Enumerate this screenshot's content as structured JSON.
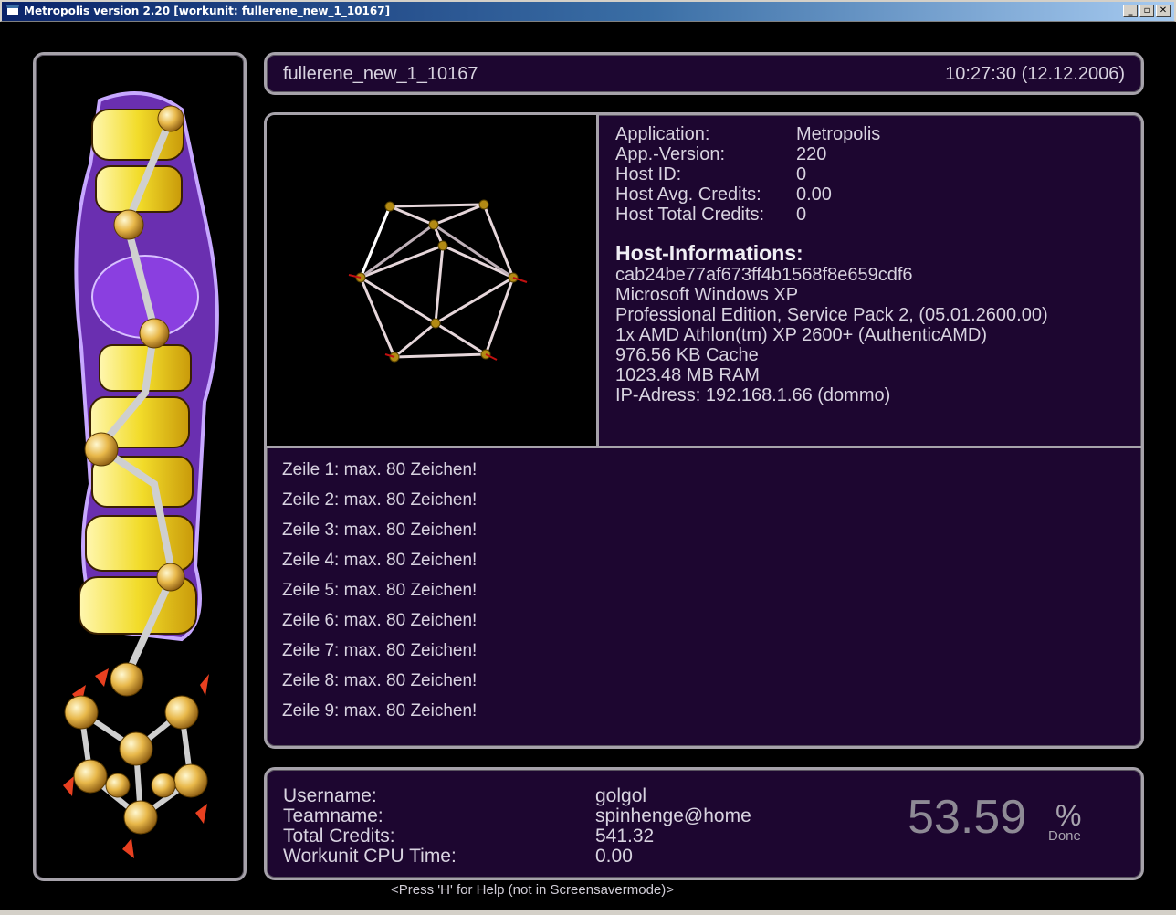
{
  "window": {
    "title": "Metropolis version 2.20 [workunit: fullerene_new_1_10167]",
    "buttons": [
      "_",
      "▫",
      "✕"
    ]
  },
  "header": {
    "workunit": "fullerene_new_1_10167",
    "datetime": "10:27:30 (12.12.2006)"
  },
  "app_info": [
    {
      "key": "Application:",
      "value": "Metropolis"
    },
    {
      "key": "App.-Version:",
      "value": "220"
    },
    {
      "key": "Host ID:",
      "value": "0"
    },
    {
      "key": "Host Avg. Credits:",
      "value": "0.00"
    },
    {
      "key": "Host Total Credits:",
      "value": "0"
    }
  ],
  "host": {
    "title": "Host-Informations:",
    "lines": [
      "cab24be77af673ff4b1568f8e659cdf6",
      "Microsoft Windows XP",
      "Professional Edition, Service Pack 2, (05.01.2600.00)",
      "1x AMD Athlon(tm) XP 2600+ (AuthenticAMD)",
      "976.56 KB Cache",
      "1023.48 MB RAM",
      "IP-Adress: 192.168.1.66 (dommo)"
    ]
  },
  "zeilen": [
    "Zeile 1: max. 80 Zeichen!",
    "Zeile 2: max. 80 Zeichen!",
    "Zeile 3: max. 80 Zeichen!",
    "Zeile 4: max. 80 Zeichen!",
    "Zeile 5: max. 80 Zeichen!",
    "Zeile 6: max. 80 Zeichen!",
    "Zeile 7: max. 80 Zeichen!",
    "Zeile 8: max. 80 Zeichen!",
    "Zeile 9: max. 80 Zeichen!"
  ],
  "user": [
    {
      "key": "Username:",
      "value": "golgol"
    },
    {
      "key": "Teamname:",
      "value": "spinhenge@home"
    },
    {
      "key": "Total Credits:",
      "value": "541.32"
    },
    {
      "key": "Workunit CPU Time:",
      "value": "0.00"
    }
  ],
  "progress": {
    "value": "53.59",
    "sign": "%",
    "label": "Done",
    "fraction": 0.5359
  },
  "help": "<Press 'H' for Help (not in Screensavermode)>",
  "colors": {
    "panel_bg": "#1d0630",
    "panel_border": "#a6a2aa",
    "text": "#d8d3e0",
    "logo_yellow": "#f2dc2a",
    "logo_purple": "#7a3fc8"
  },
  "icons": {
    "logo": "spinhenge-home-logo",
    "molecule": "molecule-icon"
  }
}
